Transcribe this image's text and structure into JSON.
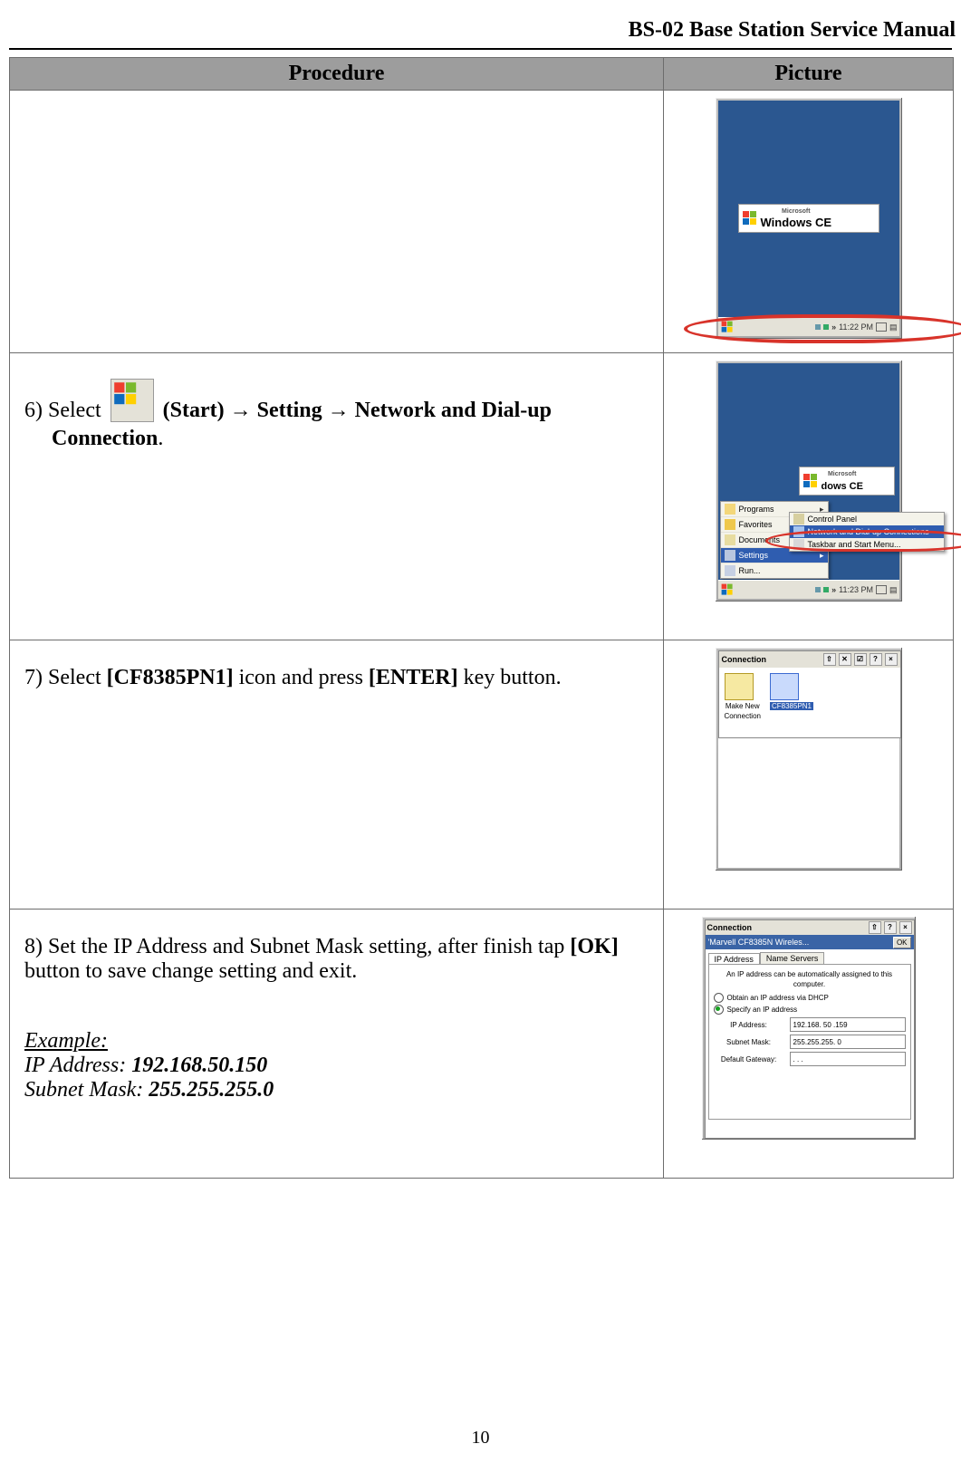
{
  "header": {
    "title": "BS-02 Base Station Service Manual"
  },
  "table": {
    "headers": {
      "procedure": "Procedure",
      "picture": "Picture"
    }
  },
  "step6": {
    "prefix": "6) Select ",
    "start": "(Start)",
    "arrow": "→",
    "setting": "Setting",
    "network": "Network and Dial-up",
    "connection": "Connection",
    "dot": "."
  },
  "step7": {
    "prefix": "7) Select ",
    "icon": "[CF8385PN1]",
    "mid": " icon and press ",
    "enter": "[ENTER]",
    "suffix": " key button."
  },
  "step8": {
    "line1a": "8) Set the IP Address and Subnet Mask setting, after finish tap ",
    "ok": "[OK]",
    "line1b": " button to save change setting and exit.",
    "example_label": "Example:",
    "ip_label": "IP Address: ",
    "ip_value": "192.168.50.150",
    "sm_label": "Subnet Mask: ",
    "sm_value": "255.255.255.0"
  },
  "wince": {
    "brand_small": "Microsoft",
    "brand": "Windows CE",
    "time_a": "11:22 PM",
    "time_b": "11:23 PM"
  },
  "start_menu": {
    "programs": "Programs",
    "favorites": "Favorites",
    "documents": "Documents",
    "settings": "Settings",
    "run": "Run..."
  },
  "settings_submenu": {
    "control_panel": "Control Panel",
    "network": "Network and Dial-up Connections",
    "taskbar": "Taskbar and Start Menu..."
  },
  "conn_window": {
    "title": "Connection",
    "make_new1": "Make New",
    "make_new2": "Connection",
    "cf_icon": "CF8385PN1"
  },
  "props_window": {
    "sysbar": "Connection",
    "title": "'Marvell CF8385N Wireles...",
    "ok": "OK",
    "tab_ip": "IP Address",
    "tab_ns": "Name Servers",
    "info": "An IP address can be automatically assigned to this computer.",
    "radio_dhcp": "Obtain an IP address via DHCP",
    "radio_static": "Specify an IP address",
    "field_ip": "IP Address:",
    "field_sm": "Subnet Mask:",
    "field_gw": "Default Gateway:",
    "val_ip": "192.168. 50 .159",
    "val_sm": "255.255.255.  0",
    "val_gw": ".    .    ."
  },
  "footer": {
    "page": "10"
  }
}
